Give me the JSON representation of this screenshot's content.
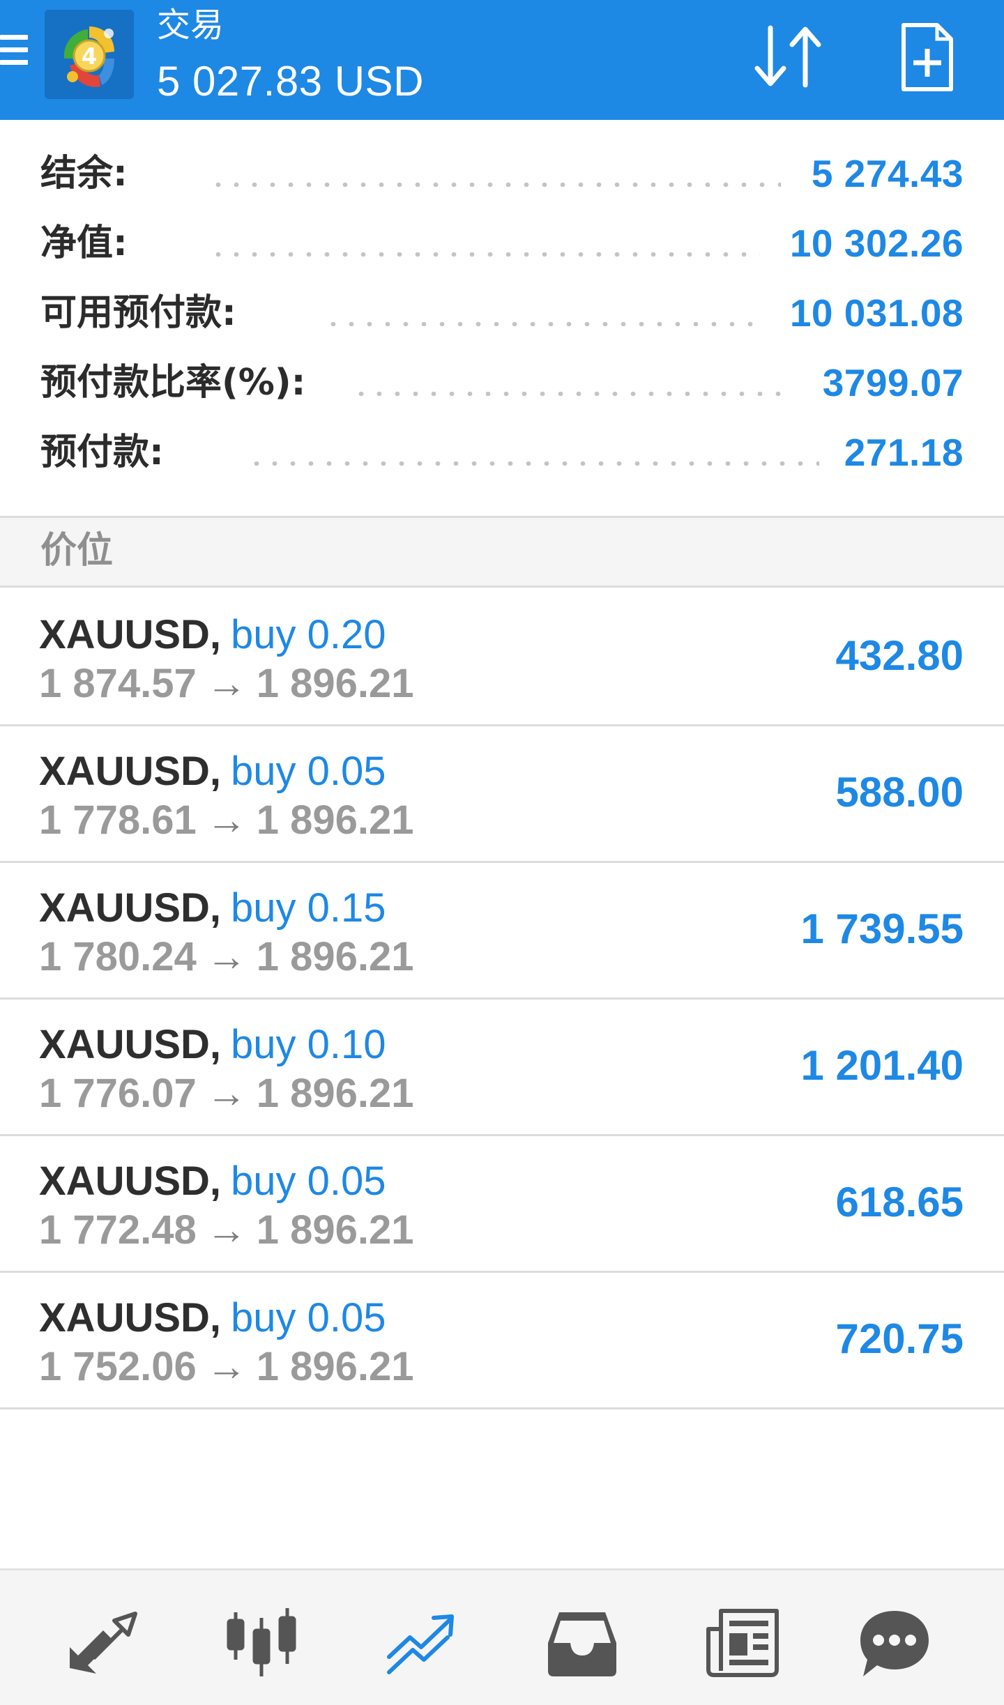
{
  "header": {
    "title": "交易",
    "balance": "5 027.83 USD",
    "icons": [
      "menu-icon",
      "metatrader-logo",
      "sort-icon",
      "new-order-icon"
    ]
  },
  "summary": [
    {
      "label": "结余:",
      "value": "5 274.43"
    },
    {
      "label": "净值:",
      "value": "10 302.26"
    },
    {
      "label": "可用预付款:",
      "value": "10 031.08"
    },
    {
      "label": "预付款比率(%):",
      "value": "3799.07"
    },
    {
      "label": "预付款:",
      "value": "271.18"
    }
  ],
  "section": {
    "title": "价位"
  },
  "positions": [
    {
      "symbol": "XAUUSD",
      "type": "buy 0.20",
      "open_price": "1 874.57",
      "current_price": "1 896.21",
      "profit": "432.80"
    },
    {
      "symbol": "XAUUSD",
      "type": "buy 0.05",
      "open_price": "1 778.61",
      "current_price": "1 896.21",
      "profit": "588.00"
    },
    {
      "symbol": "XAUUSD",
      "type": "buy 0.15",
      "open_price": "1 780.24",
      "current_price": "1 896.21",
      "profit": "1 739.55"
    },
    {
      "symbol": "XAUUSD",
      "type": "buy 0.10",
      "open_price": "1 776.07",
      "current_price": "1 896.21",
      "profit": "1 201.40"
    },
    {
      "symbol": "XAUUSD",
      "type": "buy 0.05",
      "open_price": "1 772.48",
      "current_price": "1 896.21",
      "profit": "618.65"
    },
    {
      "symbol": "XAUUSD",
      "type": "buy 0.05",
      "open_price": "1 752.06",
      "current_price": "1 896.21",
      "profit": "720.75"
    }
  ],
  "bottom_nav": [
    {
      "icon": "quotes-icon",
      "active": false
    },
    {
      "icon": "chart-icon",
      "active": false
    },
    {
      "icon": "trade-icon",
      "active": true
    },
    {
      "icon": "history-icon",
      "active": false
    },
    {
      "icon": "news-icon",
      "active": false
    },
    {
      "icon": "chat-icon",
      "active": false
    }
  ],
  "colors": {
    "accent": "#1e88e5",
    "header_bg": "#1e88e5",
    "nav_inactive": "#555555",
    "nav_active": "#1e88e5",
    "divider": "#dcdcdc"
  }
}
